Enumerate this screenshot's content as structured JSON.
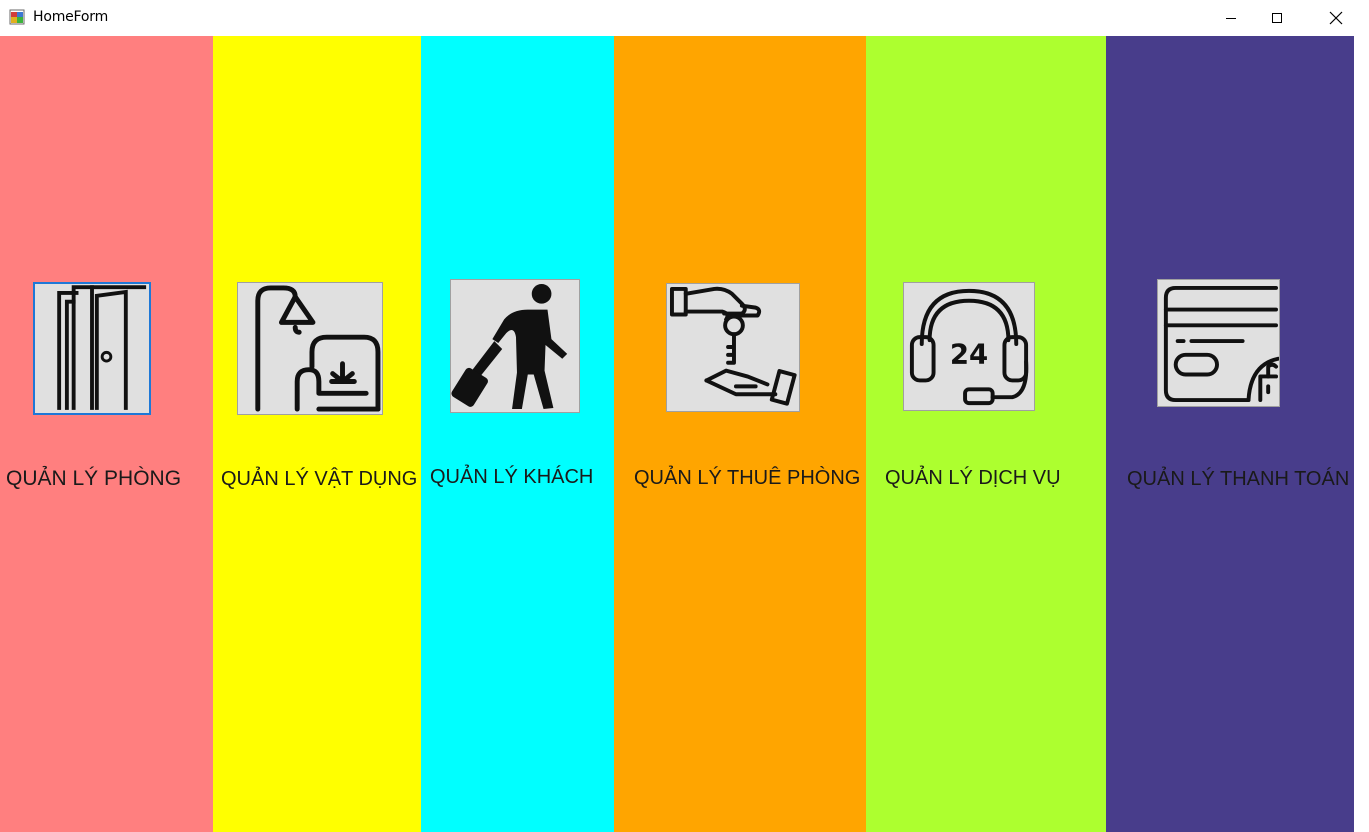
{
  "window": {
    "title": "HomeForm",
    "controls": {
      "minimize": "minimize-icon",
      "maximize": "maximize-icon",
      "close": "close-icon"
    }
  },
  "panels": [
    {
      "label": "QUẢN LÝ PHÒNG",
      "color": "#ff7f7f",
      "icon": "door-icon"
    },
    {
      "label": "QUẢN LÝ VẬT DỤNG",
      "color": "#ffff00",
      "icon": "lamp-armchair-icon"
    },
    {
      "label": "QUẢN LÝ KHÁCH",
      "color": "#00ffff",
      "icon": "traveler-luggage-icon"
    },
    {
      "label": "QUẢN LÝ THUÊ PHÒNG",
      "color": "#ffa500",
      "icon": "key-handover-icon"
    },
    {
      "label": "QUẢN LÝ DỊCH VỤ",
      "color": "#adff2f",
      "icon": "headset-24-icon"
    },
    {
      "label": "QUẢN LÝ THANH TOÁN",
      "color": "#483d8b",
      "icon": "credit-card-icon"
    }
  ]
}
